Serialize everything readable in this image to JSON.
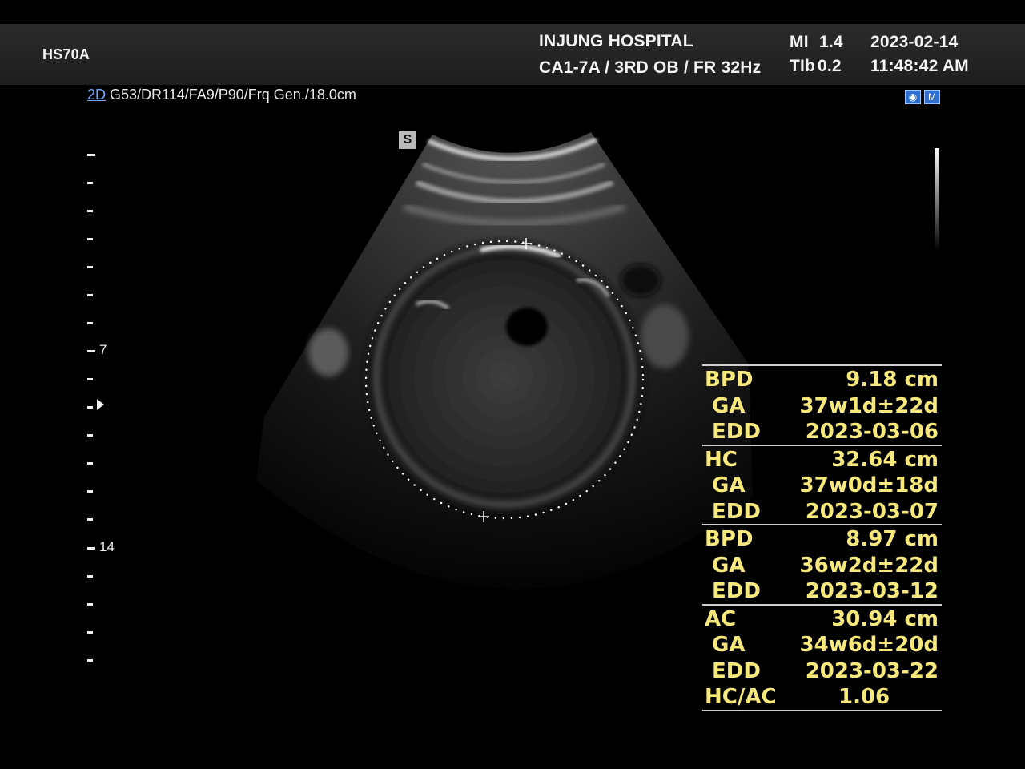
{
  "header": {
    "device": "HS70A",
    "hospital": "INJUNG HOSPITAL",
    "probe_preset": "CA1-7A / 3RD OB / FR 32Hz",
    "mi_label": "MI",
    "mi_value": "1.4",
    "tib_label": "TIb",
    "tib_value": "0.2",
    "date": "2023-02-14",
    "time": "11:48:42 AM"
  },
  "imaging": {
    "mode": "2D",
    "params": "G53/DR114/FA9/P90/Frq Gen./18.0cm",
    "orientation_marker": "S",
    "depth_labels": [
      "7",
      "14"
    ]
  },
  "colors": {
    "measurement_text": "#f6e87a",
    "header_bg": "#262626",
    "mode_link": "#6fa8ff"
  },
  "icons": [
    "eye-icon",
    "mode-m-icon",
    "calipers-cross-icon"
  ],
  "measurements": [
    {
      "label": "BPD",
      "value": "9.18 cm",
      "ga_label": "GA",
      "ga": "37w1d±22d",
      "edd_label": "EDD",
      "edd": "2023-03-06"
    },
    {
      "label": "HC",
      "value": "32.64 cm",
      "ga_label": "GA",
      "ga": "37w0d±18d",
      "edd_label": "EDD",
      "edd": "2023-03-07"
    },
    {
      "label": "BPD",
      "value": "8.97 cm",
      "ga_label": "GA",
      "ga": "36w2d±22d",
      "edd_label": "EDD",
      "edd": "2023-03-12"
    },
    {
      "label": "AC",
      "value": "30.94 cm",
      "ga_label": "GA",
      "ga": "34w6d±20d",
      "edd_label": "EDD",
      "edd": "2023-03-22"
    }
  ],
  "ratio": {
    "label": "HC/AC",
    "value": "1.06"
  }
}
